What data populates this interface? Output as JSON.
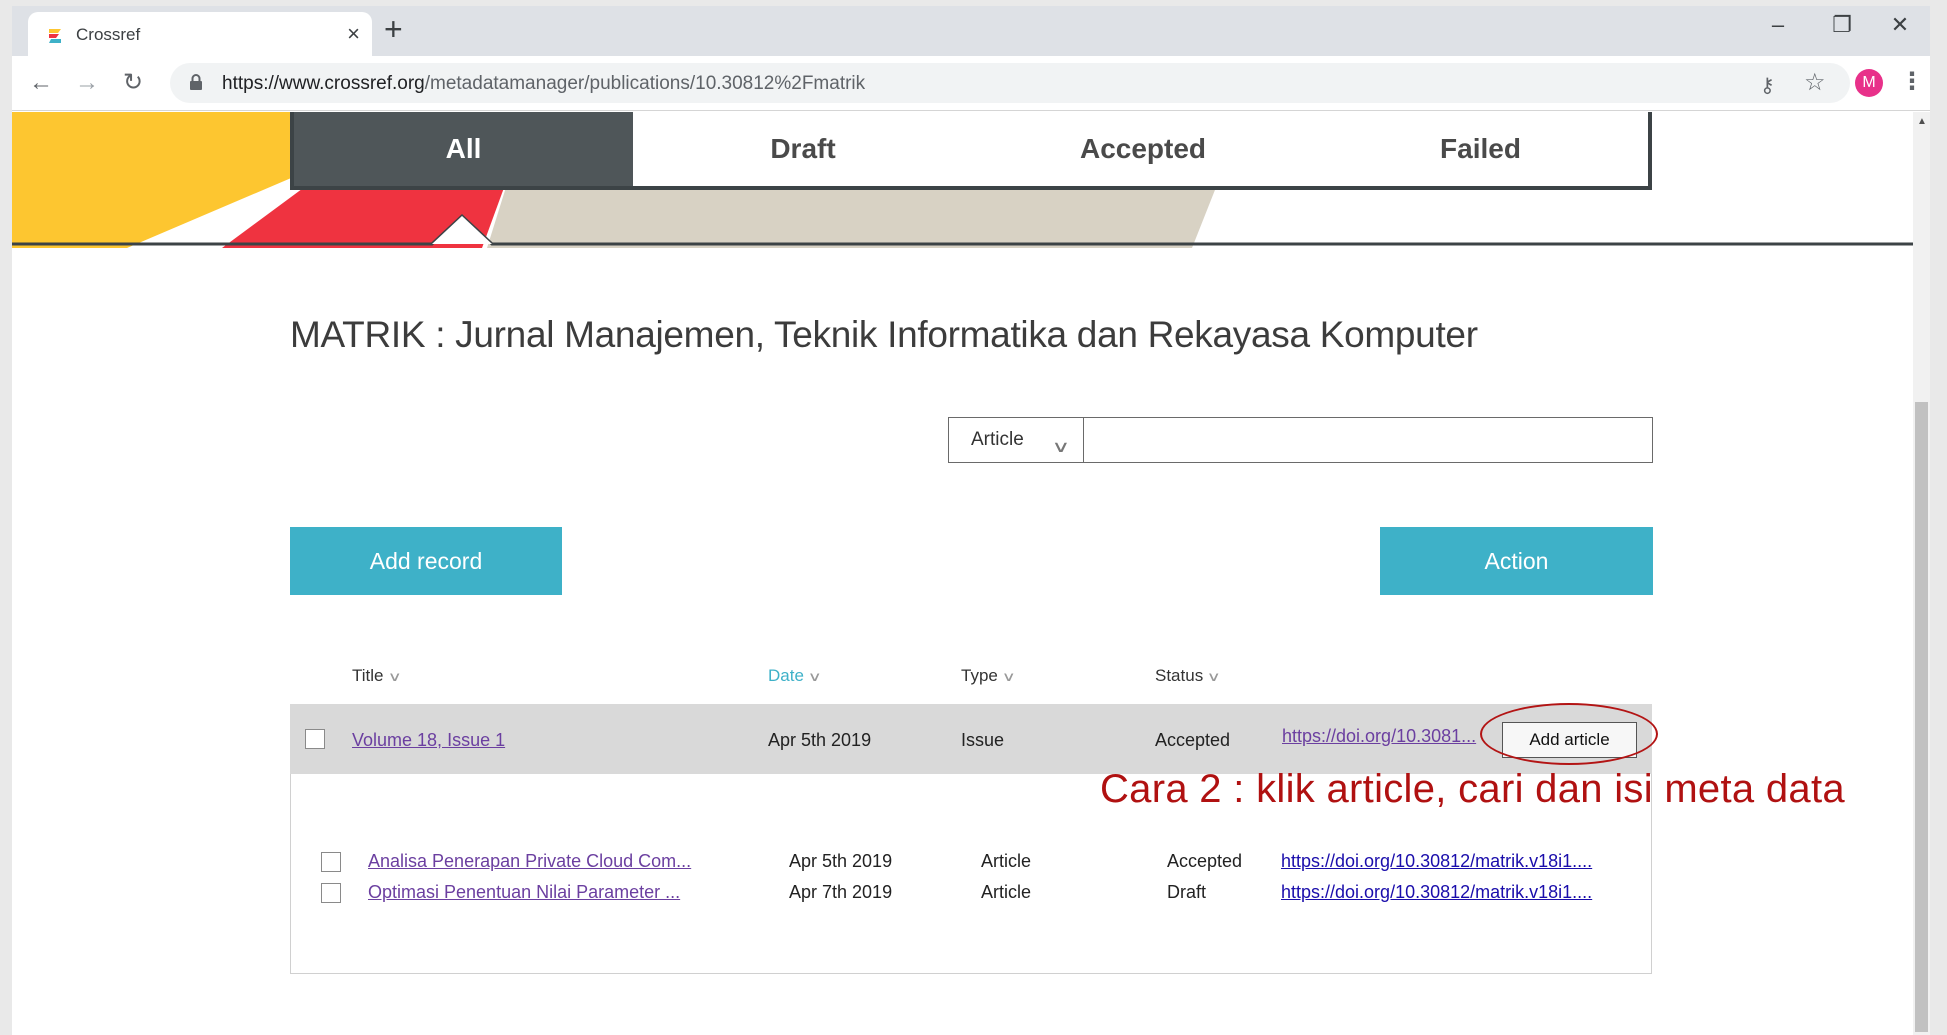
{
  "browser": {
    "tab_title": "Crossref",
    "tab_close": "×",
    "new_tab": "+",
    "url_host": "https://www.crossref.org",
    "url_path": "/metadatamanager/publications/10.30812%2Fmatrik",
    "avatar_letter": "M",
    "window_controls": {
      "minimize": "–",
      "restore": "❐",
      "close": "✕"
    },
    "nav": {
      "back": "←",
      "forward": "→",
      "reload": "↻"
    },
    "icons": {
      "key": "key-icon",
      "star": "star-icon",
      "menu": "kebab-icon"
    }
  },
  "status_tabs": [
    {
      "label": "All",
      "active": true
    },
    {
      "label": "Draft",
      "active": false
    },
    {
      "label": "Accepted",
      "active": false
    },
    {
      "label": "Failed",
      "active": false
    }
  ],
  "journal_title": "MATRIK : Jurnal Manajemen, Teknik Informatika dan Rekayasa Komputer",
  "search": {
    "type_value": "Article",
    "query_value": ""
  },
  "buttons": {
    "add_record": "Add record",
    "action": "Action",
    "add_article": "Add article"
  },
  "columns": {
    "title": "Title",
    "date": "Date",
    "type": "Type",
    "status": "Status"
  },
  "issue": {
    "title": "Volume 18, Issue 1",
    "date": "Apr 5th 2019",
    "type": "Issue",
    "status": "Accepted",
    "doi": "https://doi.org/10.3081..."
  },
  "articles": [
    {
      "title": "Analisa Penerapan Private Cloud Com...",
      "date": "Apr 5th 2019",
      "type": "Article",
      "status": "Accepted",
      "doi": "https://doi.org/10.30812/matrik.v18i1...."
    },
    {
      "title": "Optimasi Penentuan Nilai Parameter ...",
      "date": "Apr 7th 2019",
      "type": "Article",
      "status": "Draft",
      "doi": "https://doi.org/10.30812/matrik.v18i1...."
    }
  ],
  "annotation": "Cara 2 : klik article, cari dan isi meta data",
  "colors": {
    "accent": "#3eb1c8",
    "banner_yellow": "#fdc630",
    "banner_red": "#ef3340",
    "banner_beige": "#d8d2c4",
    "tab_dark": "#4f5659",
    "annotation_red": "#b01111"
  }
}
